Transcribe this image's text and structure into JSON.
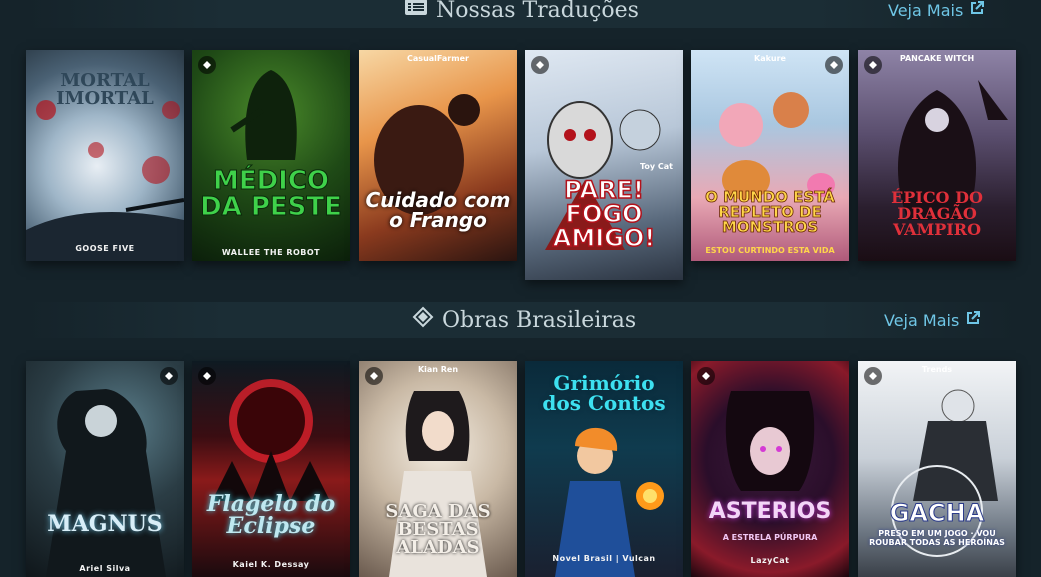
{
  "sections": [
    {
      "title": "Nossas Traduções",
      "icon": "book-list-icon",
      "link_label": "Veja Mais",
      "cards": [
        {
          "title": "MORTAL IMORTAL",
          "top": "",
          "author": "GOOSE FIVE",
          "subtitle": ""
        },
        {
          "title": "MÉDICO DA PESTE",
          "top": "",
          "author": "WALLEE THE ROBOT",
          "subtitle": ""
        },
        {
          "title": "Cuidado com o Frango",
          "top": "CasualFarmer",
          "author": "",
          "subtitle": ""
        },
        {
          "title": "PARE! FOGO AMIGO!",
          "top": "Toy Cat",
          "author": "",
          "subtitle": ""
        },
        {
          "title": "O MUNDO ESTÁ REPLETO DE MONSTROS",
          "top": "Kakure",
          "author": "",
          "subtitle": "ESTOU CURTINDO ESTA VIDA"
        },
        {
          "title": "ÉPICO DO DRAGÃO VAMPIRO",
          "top": "PANCAKE WITCH",
          "author": "",
          "subtitle": ""
        }
      ]
    },
    {
      "title": "Obras Brasileiras",
      "icon": "diamond-logo-icon",
      "link_label": "Veja Mais",
      "cards": [
        {
          "title": "MAGNUS",
          "top": "",
          "author": "Ariel Silva",
          "subtitle": ""
        },
        {
          "title": "Flagelo do Eclipse",
          "top": "",
          "author": "Kaiel K. Dessay",
          "subtitle": ""
        },
        {
          "title": "SAGA DAS BESTAS ALADAS",
          "top": "Kian Ren",
          "author": "",
          "subtitle": ""
        },
        {
          "title": "Grimório dos Contos",
          "top": "",
          "author": "Novel Brasil | Vulcan",
          "subtitle": ""
        },
        {
          "title": "ASTERIOS",
          "top": "",
          "author": "LazyCat",
          "subtitle": "A ESTRELA PÚRPURA"
        },
        {
          "title": "GACHA",
          "top": "Trends",
          "author": "",
          "subtitle": "PRESO EM UM JOGO · VOU ROUBAR TODAS AS HEROÍNAS"
        }
      ]
    }
  ],
  "colors": {
    "background": "#15232a",
    "header_bar": "#1b2d35",
    "link": "#6fc6e6",
    "title": "#c9d7dc"
  }
}
